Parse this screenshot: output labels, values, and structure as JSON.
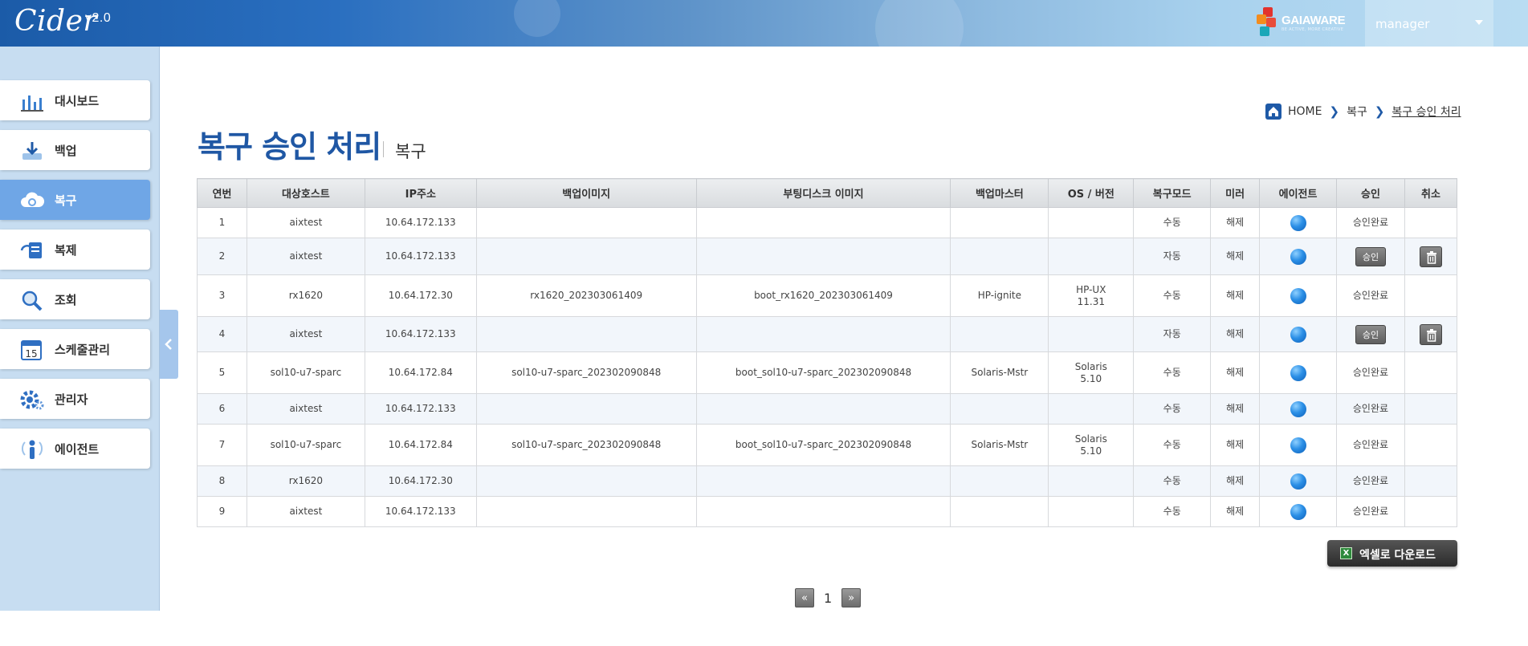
{
  "app": {
    "logo": "Cider",
    "version": "v2.0"
  },
  "brand": {
    "name": "GAIAWARE",
    "tagline": "BE ACTIVE, MORE CREATIVE"
  },
  "user": {
    "name": "manager"
  },
  "sidebar": {
    "items": [
      {
        "label": "대시보드",
        "icon": "dashboard-icon"
      },
      {
        "label": "백업",
        "icon": "backup-icon"
      },
      {
        "label": "복구",
        "icon": "restore-cloud-icon",
        "active": true
      },
      {
        "label": "복제",
        "icon": "replicate-icon"
      },
      {
        "label": "조회",
        "icon": "search-icon"
      },
      {
        "label": "스케줄관리",
        "icon": "calendar-icon",
        "calendar_day": "15"
      },
      {
        "label": "관리자",
        "icon": "gear-icon"
      },
      {
        "label": "에이전트",
        "icon": "agent-icon"
      }
    ]
  },
  "breadcrumb": {
    "home": "HOME",
    "section": "복구",
    "current": "복구 승인 처리"
  },
  "page": {
    "title": "복구 승인 처리",
    "subtitle": "복구"
  },
  "table": {
    "headers": [
      "연번",
      "대상호스트",
      "IP주소",
      "백업이미지",
      "부팅디스크 이미지",
      "백업마스터",
      "OS / 버전",
      "복구모드",
      "미러",
      "에이전트",
      "승인",
      "취소"
    ],
    "rows": [
      {
        "no": "1",
        "host": "aixtest",
        "ip": "10.64.172.133",
        "backup_image": "",
        "boot_image": "",
        "master": "",
        "os": "",
        "os_ver": "",
        "mode": "수동",
        "mirror": "해제",
        "approval": "승인완료",
        "approve_btn": false,
        "cancel": false
      },
      {
        "no": "2",
        "host": "aixtest",
        "ip": "10.64.172.133",
        "backup_image": "",
        "boot_image": "",
        "master": "",
        "os": "",
        "os_ver": "",
        "mode": "자동",
        "mirror": "해제",
        "approval": "승인",
        "approve_btn": true,
        "cancel": true
      },
      {
        "no": "3",
        "host": "rx1620",
        "ip": "10.64.172.30",
        "backup_image": "rx1620_202303061409",
        "boot_image": "boot_rx1620_202303061409",
        "master": "HP-ignite",
        "os": "HP-UX",
        "os_ver": "11.31",
        "mode": "수동",
        "mirror": "해제",
        "approval": "승인완료",
        "approve_btn": false,
        "cancel": false
      },
      {
        "no": "4",
        "host": "aixtest",
        "ip": "10.64.172.133",
        "backup_image": "",
        "boot_image": "",
        "master": "",
        "os": "",
        "os_ver": "",
        "mode": "자동",
        "mirror": "해제",
        "approval": "승인",
        "approve_btn": true,
        "cancel": true
      },
      {
        "no": "5",
        "host": "sol10-u7-sparc",
        "ip": "10.64.172.84",
        "backup_image": "sol10-u7-sparc_202302090848",
        "boot_image": "boot_sol10-u7-sparc_202302090848",
        "master": "Solaris-Mstr",
        "os": "Solaris",
        "os_ver": "5.10",
        "mode": "수동",
        "mirror": "해제",
        "approval": "승인완료",
        "approve_btn": false,
        "cancel": false
      },
      {
        "no": "6",
        "host": "aixtest",
        "ip": "10.64.172.133",
        "backup_image": "",
        "boot_image": "",
        "master": "",
        "os": "",
        "os_ver": "",
        "mode": "수동",
        "mirror": "해제",
        "approval": "승인완료",
        "approve_btn": false,
        "cancel": false
      },
      {
        "no": "7",
        "host": "sol10-u7-sparc",
        "ip": "10.64.172.84",
        "backup_image": "sol10-u7-sparc_202302090848",
        "boot_image": "boot_sol10-u7-sparc_202302090848",
        "master": "Solaris-Mstr",
        "os": "Solaris",
        "os_ver": "5.10",
        "mode": "수동",
        "mirror": "해제",
        "approval": "승인완료",
        "approve_btn": false,
        "cancel": false
      },
      {
        "no": "8",
        "host": "rx1620",
        "ip": "10.64.172.30",
        "backup_image": "",
        "boot_image": "",
        "master": "",
        "os": "",
        "os_ver": "",
        "mode": "수동",
        "mirror": "해제",
        "approval": "승인완료",
        "approve_btn": false,
        "cancel": false
      },
      {
        "no": "9",
        "host": "aixtest",
        "ip": "10.64.172.133",
        "backup_image": "",
        "boot_image": "",
        "master": "",
        "os": "",
        "os_ver": "",
        "mode": "수동",
        "mirror": "해제",
        "approval": "승인완료",
        "approve_btn": false,
        "cancel": false
      }
    ]
  },
  "excel_button": {
    "label": "엑셀로 다운로드",
    "icon_text": "X"
  },
  "pagination": {
    "prev": "«",
    "current": "1",
    "next": "»"
  },
  "colors": {
    "accent": "#1f57a4",
    "active_nav": "#6fa6e6",
    "sidebar_bg": "#c7ddf1",
    "agent_dot": "#2b8fe6"
  }
}
